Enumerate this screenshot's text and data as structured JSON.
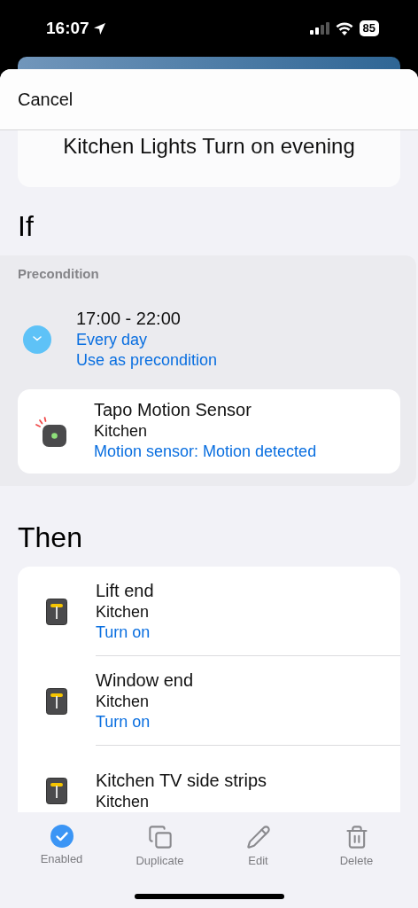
{
  "status_bar": {
    "time": "16:07",
    "battery": "85"
  },
  "header": {
    "cancel": "Cancel"
  },
  "title": "Kitchen Lights Turn on evening",
  "if_section": {
    "heading": "If",
    "precondition": {
      "label": "Precondition",
      "schedule": {
        "time": "17:00 - 22:00",
        "repeat": "Every day",
        "mode": "Use as precondition"
      }
    },
    "triggers": [
      {
        "name": "Tapo Motion Sensor",
        "room": "Kitchen",
        "condition": "Motion sensor: Motion detected"
      }
    ]
  },
  "then_section": {
    "heading": "Then",
    "actions": [
      {
        "name": "Lift end",
        "room": "Kitchen",
        "action": "Turn on"
      },
      {
        "name": "Window end",
        "room": "Kitchen",
        "action": "Turn on"
      },
      {
        "name": "Kitchen TV side strips",
        "room": "Kitchen"
      }
    ]
  },
  "toolbar": [
    {
      "kind": "toggle",
      "label": "Enabled",
      "on": true
    },
    {
      "kind": "duplicate",
      "label": "Duplicate"
    },
    {
      "kind": "edit",
      "label": "Edit"
    },
    {
      "kind": "delete",
      "label": "Delete"
    }
  ]
}
